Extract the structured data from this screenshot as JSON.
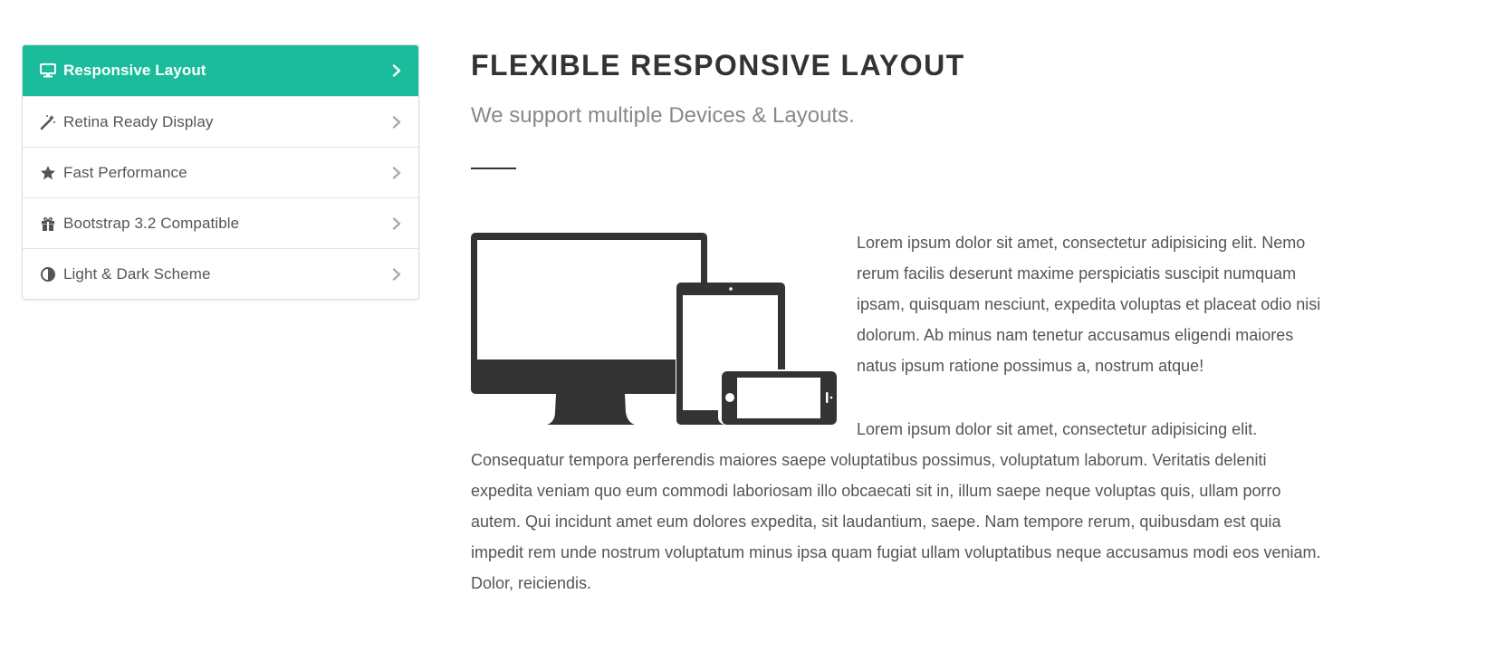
{
  "tabs": [
    {
      "label": "Responsive Layout",
      "icon": "desktop-icon",
      "active": true
    },
    {
      "label": "Retina Ready Display",
      "icon": "magic-wand-icon",
      "active": false
    },
    {
      "label": "Fast Performance",
      "icon": "star-icon",
      "active": false
    },
    {
      "label": "Bootstrap 3.2 Compatible",
      "icon": "gift-icon",
      "active": false
    },
    {
      "label": "Light & Dark Scheme",
      "icon": "adjust-icon",
      "active": false
    }
  ],
  "main": {
    "title": "FLEXIBLE RESPONSIVE LAYOUT",
    "subtitle": "We support multiple Devices & Layouts.",
    "image": "devices-illustration",
    "paragraphs": [
      "Lorem ipsum dolor sit amet, consectetur adipisicing elit. Nemo rerum facilis deserunt maxime perspiciatis suscipit numquam ipsam, quisquam nesciunt, expedita voluptas et placeat odio nisi dolorum. Ab minus nam tenetur accusamus eligendi maiores natus ipsum ratione possimus a, nostrum atque!",
      "Lorem ipsum dolor sit amet, consectetur adipisicing elit. Consequatur tempora perferendis maiores saepe voluptatibus possimus, voluptatum laborum. Veritatis deleniti expedita veniam quo eum commodi laboriosam illo obcaecati sit in, illum saepe neque voluptas quis, ullam porro autem. Qui incidunt amet eum dolores expedita, sit laudantium, saepe. Nam tempore rerum, quibusdam est quia impedit rem unde nostrum voluptatum minus ipsa quam fugiat ullam voluptatibus neque accusamus modi eos veniam. Dolor, reiciendis."
    ]
  },
  "colors": {
    "accent": "#1abc9c",
    "heading": "#333333",
    "text": "#555555",
    "subtitle": "#888888",
    "border": "#dddddd"
  }
}
